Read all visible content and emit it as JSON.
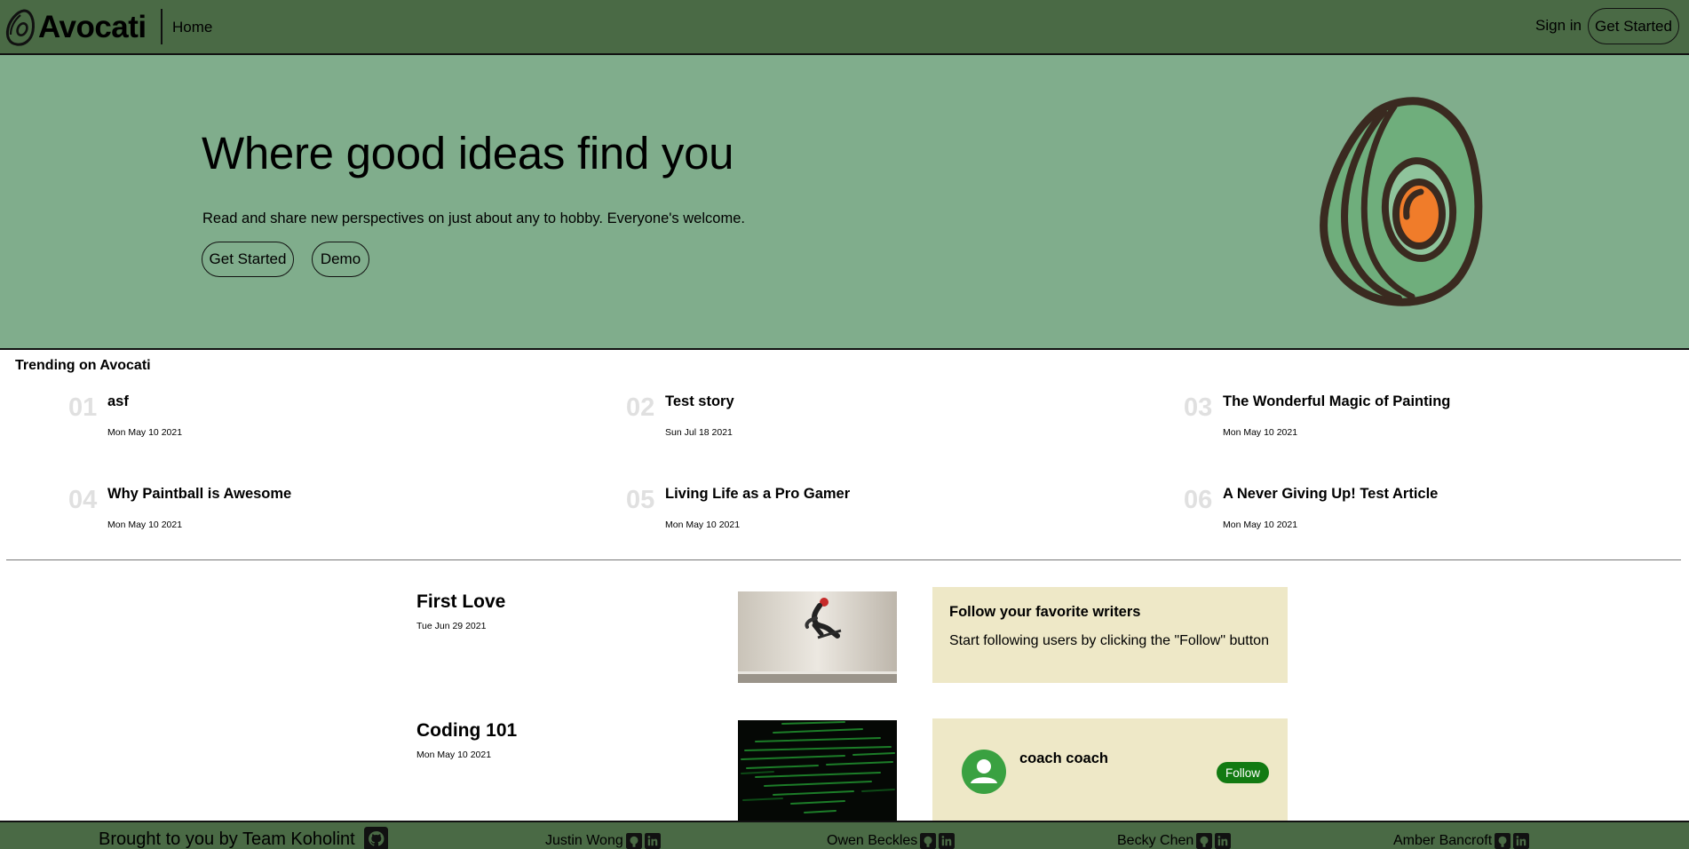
{
  "nav": {
    "logo": "Avocati",
    "home": "Home",
    "sign_in": "Sign in",
    "get_started": "Get Started"
  },
  "hero": {
    "title": "Where good ideas find you",
    "subtitle": "Read and share new perspectives on just about any to hobby. Everyone's welcome.",
    "get_started": "Get Started",
    "demo": "Demo"
  },
  "trending": {
    "title": "Trending on Avocati",
    "items": [
      {
        "num": "01",
        "title": "asf",
        "date": "Mon May 10 2021"
      },
      {
        "num": "02",
        "title": "Test story",
        "date": "Sun Jul 18 2021"
      },
      {
        "num": "03",
        "title": "The Wonderful Magic of Painting",
        "date": "Mon May 10 2021"
      },
      {
        "num": "04",
        "title": "Why Paintball is Awesome",
        "date": "Mon May 10 2021"
      },
      {
        "num": "05",
        "title": "Living Life as a Pro Gamer",
        "date": "Mon May 10 2021"
      },
      {
        "num": "06",
        "title": "A Never Giving Up! Test Article",
        "date": "Mon May 10 2021"
      }
    ]
  },
  "stories": [
    {
      "title": "First Love",
      "date": "Tue Jun 29 2021",
      "image": "skateboard-photo"
    },
    {
      "title": "Coding 101",
      "date": "Mon May 10 2021",
      "image": "code-screen-photo"
    }
  ],
  "panel": {
    "heading": "Follow your favorite writers",
    "text": "Start following users by clicking the \"Follow\" button",
    "user_name": "coach coach",
    "follow": "Follow"
  },
  "footer": {
    "brand": "Brought to you by Team Koholint",
    "people": [
      "Justin Wong",
      "Owen Beckles",
      "Becky Chen",
      "Amber Bancroft"
    ],
    "icons": [
      "github-icon",
      "linkedin-icon"
    ]
  },
  "colors": {
    "nav_bg": "#4a6a45",
    "hero_bg": "#80ad8c",
    "panel_bg": "#eee8c7",
    "follow_btn": "#127a12",
    "avatar_bg": "#3aa141",
    "avocado_pit": "#f07c2a"
  }
}
